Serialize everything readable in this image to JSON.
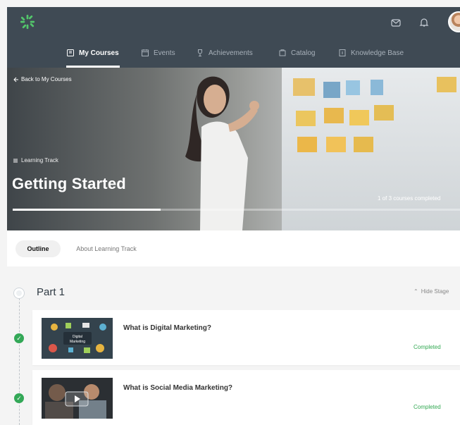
{
  "header": {
    "logo_icon": "leaf-cluster-icon",
    "mail_icon": "mail-icon",
    "bell_icon": "bell-icon",
    "avatar_icon": "user-avatar"
  },
  "nav": {
    "items": [
      {
        "label": "My Courses",
        "icon": "book-icon",
        "active": true
      },
      {
        "label": "Events",
        "icon": "calendar-icon",
        "active": false
      },
      {
        "label": "Achievements",
        "icon": "trophy-icon",
        "active": false
      },
      {
        "label": "Catalog",
        "icon": "catalog-icon",
        "active": false
      },
      {
        "label": "Knowledge Base",
        "icon": "info-book-icon",
        "active": false
      }
    ]
  },
  "hero": {
    "back_label": "Back to My Courses",
    "track_label": "Learning Track",
    "title": "Getting Started",
    "progress_text": "1 of 3 courses completed",
    "progress_fraction": 0.33
  },
  "tabs": [
    {
      "label": "Outline",
      "active": true
    },
    {
      "label": "About Learning Track",
      "active": false
    }
  ],
  "stage": {
    "title": "Part 1",
    "hide_label": "Hide Stage"
  },
  "courses": [
    {
      "title": "What is Digital Marketing?",
      "status": "Completed",
      "thumb_text": "Digital Marketing"
    },
    {
      "title": "What is Social Media Marketing?",
      "status": "Completed",
      "thumb_text": ""
    }
  ],
  "colors": {
    "header": "#3f4a54",
    "success": "#33a857",
    "accent": "#55c96b"
  }
}
